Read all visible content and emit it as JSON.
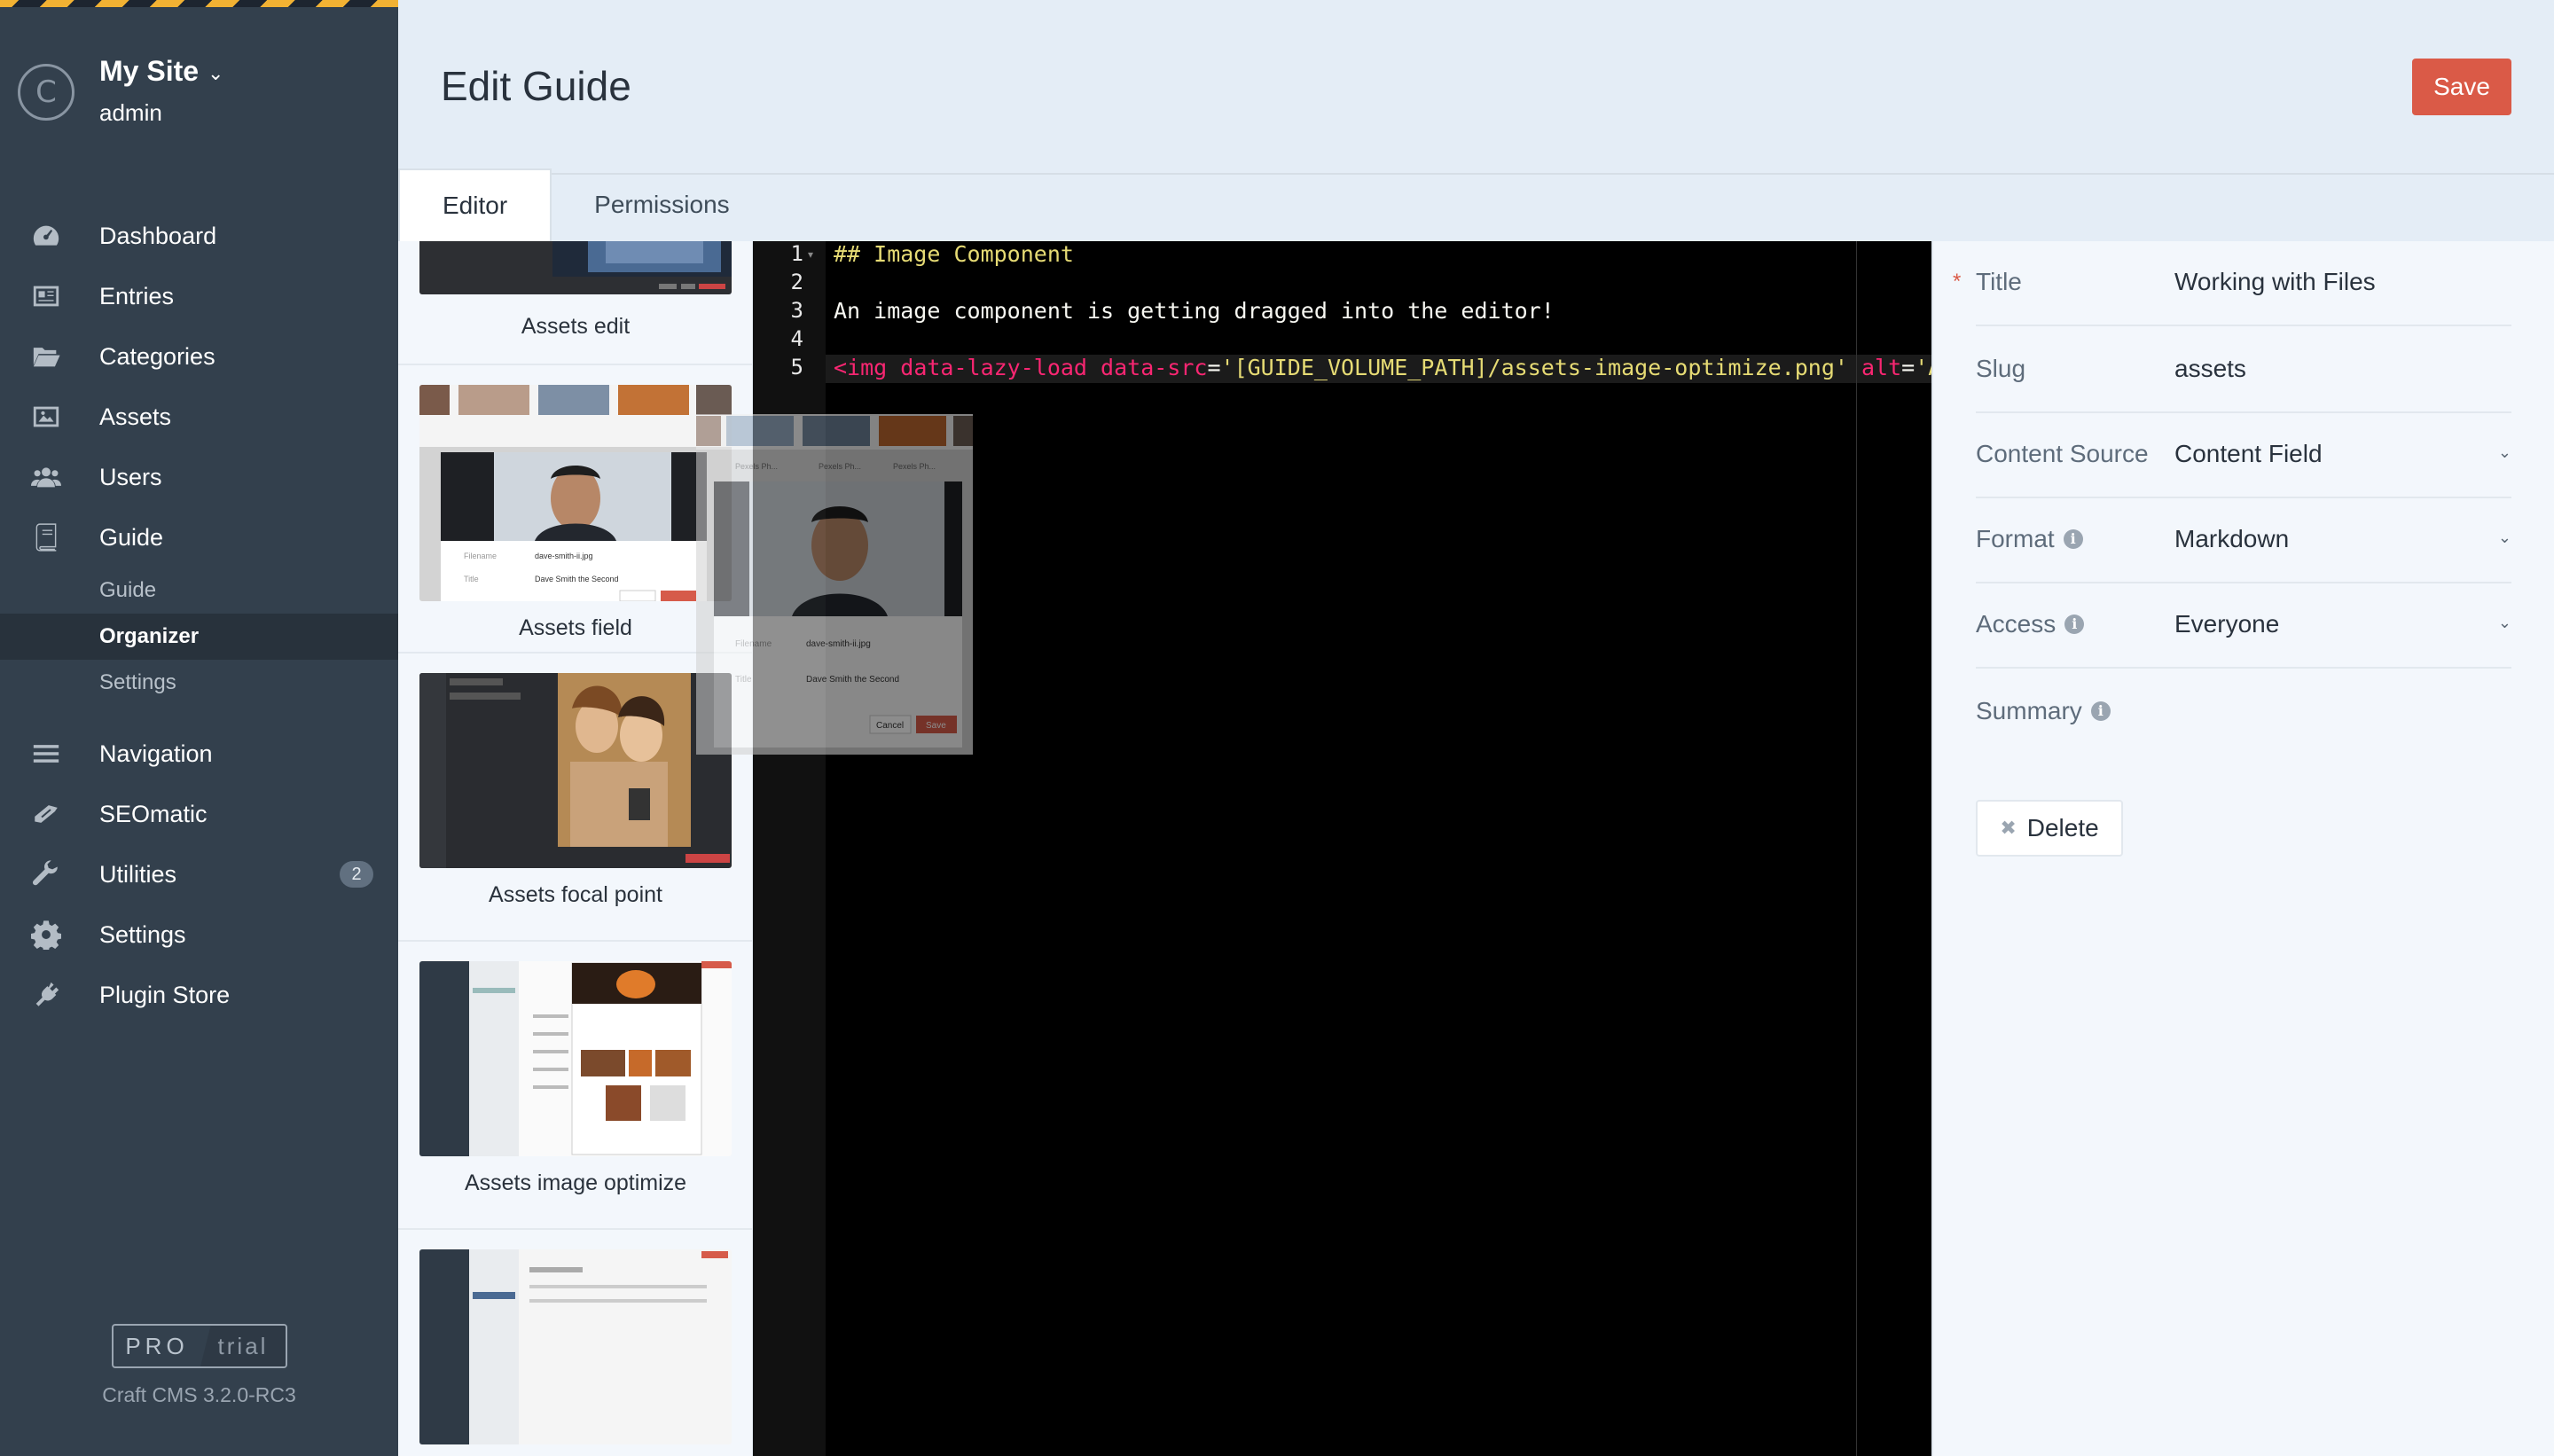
{
  "site": {
    "name": "My Site",
    "user": "admin",
    "avatar_letter": "C"
  },
  "nav": {
    "items": [
      {
        "label": "Dashboard",
        "icon": "dashboard-icon"
      },
      {
        "label": "Entries",
        "icon": "entries-icon"
      },
      {
        "label": "Categories",
        "icon": "folder-icon"
      },
      {
        "label": "Assets",
        "icon": "image-icon"
      },
      {
        "label": "Users",
        "icon": "users-icon"
      },
      {
        "label": "Guide",
        "icon": "book-icon"
      },
      {
        "label": "Navigation",
        "icon": "hamburger-icon"
      },
      {
        "label": "SEOmatic",
        "icon": "seomatic-icon"
      },
      {
        "label": "Utilities",
        "icon": "wrench-icon",
        "badge": "2"
      },
      {
        "label": "Settings",
        "icon": "gear-icon"
      },
      {
        "label": "Plugin Store",
        "icon": "plug-icon"
      }
    ],
    "guide_subitems": [
      {
        "label": "Guide"
      },
      {
        "label": "Organizer",
        "selected": true
      },
      {
        "label": "Settings"
      }
    ]
  },
  "edition": {
    "pro": "PRO",
    "trial": "trial"
  },
  "version": "Craft CMS 3.2.0-RC3",
  "header": {
    "title": "Edit Guide",
    "save_label": "Save"
  },
  "tabs": [
    {
      "label": "Editor",
      "active": true
    },
    {
      "label": "Permissions",
      "active": false
    }
  ],
  "components": [
    {
      "label": "Assets edit"
    },
    {
      "label": "Assets field"
    },
    {
      "label": "Assets focal point"
    },
    {
      "label": "Assets image optimize"
    }
  ],
  "thumb_text": {
    "filename_label": "Filename",
    "filename_value": "dave-smith-ii.jpg",
    "title_label": "Title",
    "title_value": "Dave Smith the Second",
    "cancel": "Cancel",
    "save": "Save",
    "pexels": "Pexels Ph..."
  },
  "editor": {
    "line_numbers": [
      "1",
      "2",
      "3",
      "4",
      "5"
    ],
    "line1": "## Image Component",
    "line3": "An image component is getting dragged into the editor!",
    "line5": {
      "tag_open": "<img",
      "attr1": " data-lazy-load",
      "attr2": " data-src",
      "eq1": "=",
      "val1": "'[GUIDE_VOLUME_PATH]/assets-image-optimize.png'",
      "attr3": " alt",
      "eq2": "=",
      "val2": "'Asse"
    }
  },
  "fields": {
    "title": {
      "label": "Title",
      "value": "Working with Files",
      "required_mark": "*"
    },
    "slug": {
      "label": "Slug",
      "value": "assets"
    },
    "content_source": {
      "label": "Content Source",
      "value": "Content Field"
    },
    "format": {
      "label": "Format",
      "value": "Markdown"
    },
    "access": {
      "label": "Access",
      "value": "Everyone"
    },
    "summary": {
      "label": "Summary",
      "value": ""
    },
    "info_glyph": "i",
    "chevron": "⌄",
    "delete_label": "Delete",
    "delete_glyph": "✖"
  },
  "colors": {
    "sidebar": "#33404d",
    "accent": "#da5a47",
    "header": "#e4edf6"
  }
}
